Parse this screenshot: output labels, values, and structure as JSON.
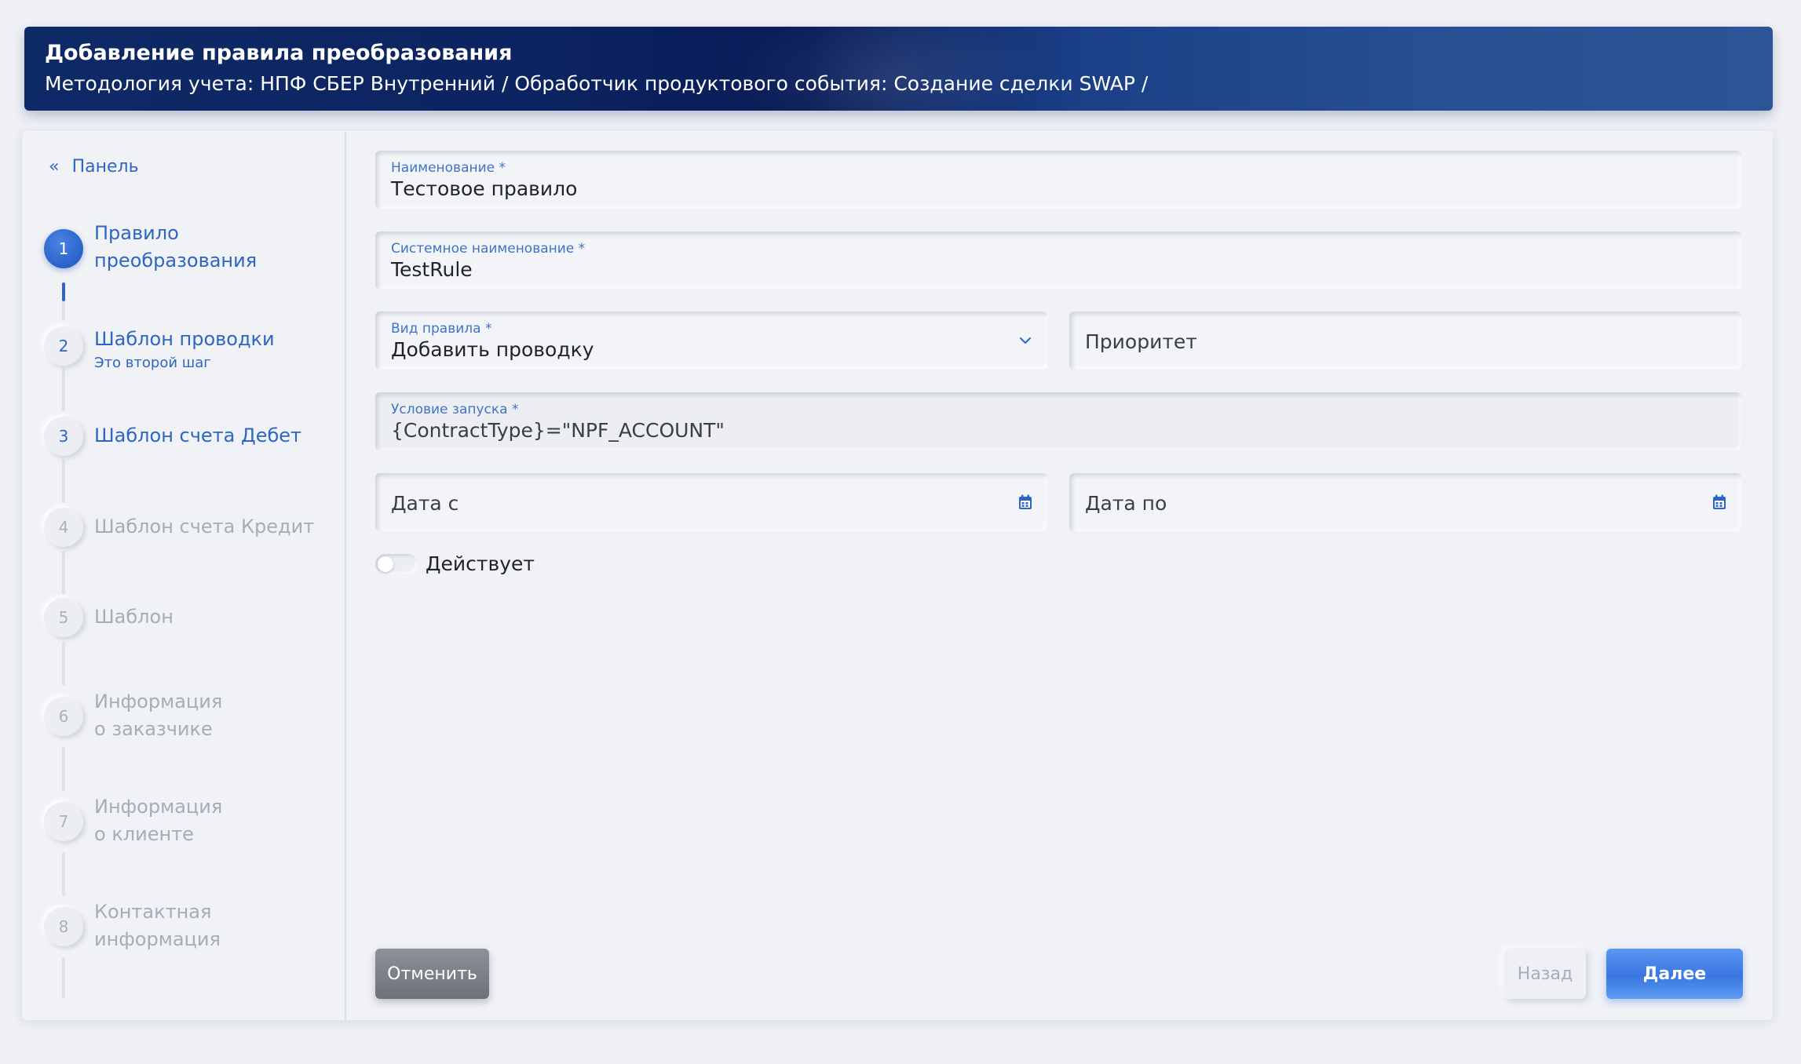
{
  "header": {
    "title": "Добавление правила преобразования",
    "breadcrumb": "Методология учета: НПФ СБЕР Внутренний / Обработчик продуктового события: Создание сделки SWAP /"
  },
  "sidebar": {
    "panel_link": "Панель",
    "steps": [
      {
        "number": "1",
        "label_line1": "Правило",
        "label_line2": "преобразования",
        "state": "active"
      },
      {
        "number": "2",
        "label_line1": "Шаблон проводки",
        "sub": "Это второй шаг",
        "state": "enabled"
      },
      {
        "number": "3",
        "label_line1": "Шаблон счета Дебет",
        "state": "enabled"
      },
      {
        "number": "4",
        "label_line1": "Шаблон счета Кредит",
        "state": "disabled"
      },
      {
        "number": "5",
        "label_line1": "Шаблон",
        "state": "disabled"
      },
      {
        "number": "6",
        "label_line1": "Информация",
        "label_line2": "о заказчике",
        "state": "disabled"
      },
      {
        "number": "7",
        "label_line1": "Информация",
        "label_line2": "о клиенте",
        "state": "disabled"
      },
      {
        "number": "8",
        "label_line1": "Контактная",
        "label_line2": "информация",
        "state": "disabled"
      }
    ]
  },
  "form": {
    "name": {
      "label": "Наименование *",
      "value": "Тестовое правило"
    },
    "system_name": {
      "label": "Системное наименование *",
      "value": "TestRule"
    },
    "rule_type": {
      "label": "Вид правила *",
      "value": "Добавить проводку"
    },
    "priority": {
      "placeholder": "Приоритет"
    },
    "launch_condition": {
      "label": "Условие запуска *",
      "value": "{ContractType}=\"NPF_ACCOUNT\""
    },
    "date_from": {
      "placeholder": "Дата с"
    },
    "date_to": {
      "placeholder": "Дата по"
    },
    "active_toggle": {
      "label": "Действует",
      "checked": false
    }
  },
  "buttons": {
    "cancel": "Отменить",
    "back": "Назад",
    "next": "Далее"
  },
  "colors": {
    "accent": "#2d66c4",
    "primary_button": "#3a76e0",
    "header_bg": "#0c2461"
  }
}
